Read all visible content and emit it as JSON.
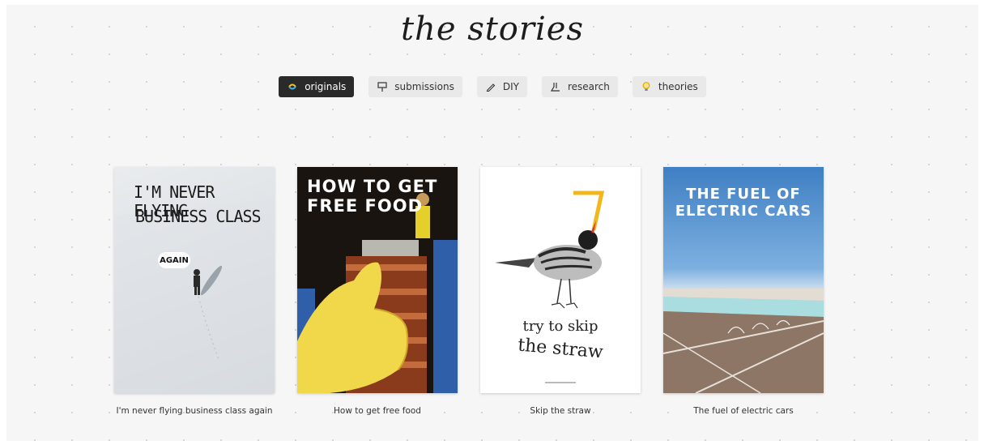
{
  "header": {
    "logo_text": "the stories"
  },
  "tabs": [
    {
      "label": "originals",
      "icon": "swirl-icon",
      "active": true
    },
    {
      "label": "submissions",
      "icon": "sign-icon",
      "active": false
    },
    {
      "label": "DIY",
      "icon": "pencil-icon",
      "active": false
    },
    {
      "label": "research",
      "icon": "flask-icon",
      "active": false
    },
    {
      "label": "theories",
      "icon": "lightbulb-icon",
      "active": false
    }
  ],
  "cards": [
    {
      "caption": "I'm never flying business class again",
      "poster_line1": "I'M NEVER FLYING",
      "poster_line2": "BUSINESS CLASS",
      "poster_badge": "AGAIN"
    },
    {
      "caption": "How to get free food",
      "poster_text": "HOW TO GET FREE FOOD"
    },
    {
      "caption": "Skip the straw",
      "poster_line1": "try to skip",
      "poster_line2": "the straw"
    },
    {
      "caption": "The fuel of electric cars",
      "poster_text": "THE FUEL OF ELECTRIC CARS"
    }
  ],
  "colors": {
    "active_tab_bg": "#2a2a2a",
    "tab_bg": "#e9e9e9",
    "page_bg": "#f6f6f6",
    "lightbulb": "#f4c430"
  }
}
